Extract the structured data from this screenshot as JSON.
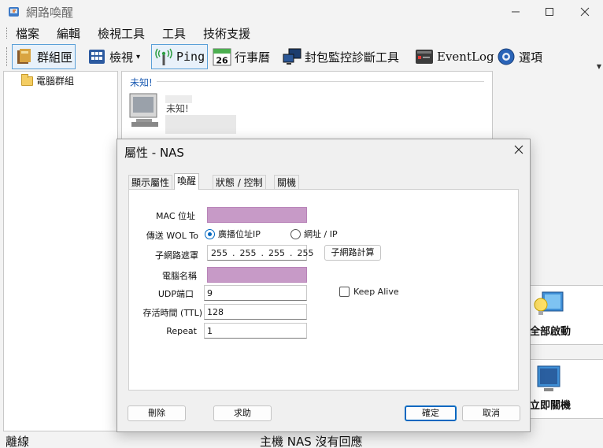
{
  "window": {
    "title": "網路喚醒"
  },
  "menu": [
    "檔案",
    "編輯",
    "檢視工具",
    "工具",
    "技術支援"
  ],
  "toolbar": {
    "groups": "群組匣",
    "view": "檢視",
    "ping": "Ping",
    "calendar_day": "26",
    "calendar": "行事曆",
    "packet": "封包監控診斷工具",
    "eventlog": "EventLog",
    "options": "選項"
  },
  "tree": {
    "root": "電腦群組"
  },
  "content": {
    "group_label": "未知!",
    "host_status": "未知!"
  },
  "actions": {
    "wake_all": "全部啟動",
    "shutdown": "立即關機"
  },
  "status": {
    "left": "離線",
    "center": "主機 NAS 沒有回應"
  },
  "dialog": {
    "title": "屬性 - NAS",
    "tabs": [
      "顯示屬性",
      "喚醒",
      "狀態 / 控制",
      "關機"
    ],
    "selected_tab": 1,
    "labels": {
      "mac": "MAC 位址",
      "send_to": "傳送 WOL To",
      "subnet": "子網路遮罩",
      "name": "電腦名稱",
      "udp": "UDP端口",
      "ttl": "存活時間 (TTL)",
      "repeat": "Repeat"
    },
    "send_options": [
      "廣播位址IP",
      "網址 / IP"
    ],
    "send_selected": 0,
    "subnet_octets": [
      "255",
      "255",
      "255",
      "255"
    ],
    "subnet_calc_button": "子網路計算",
    "udp_value": "9",
    "ttl_value": "128",
    "repeat_value": "1",
    "keep_alive": "Keep Alive",
    "keep_alive_checked": false,
    "buttons": {
      "delete": "刪除",
      "help": "求助",
      "ok": "確定",
      "cancel": "取消"
    }
  }
}
